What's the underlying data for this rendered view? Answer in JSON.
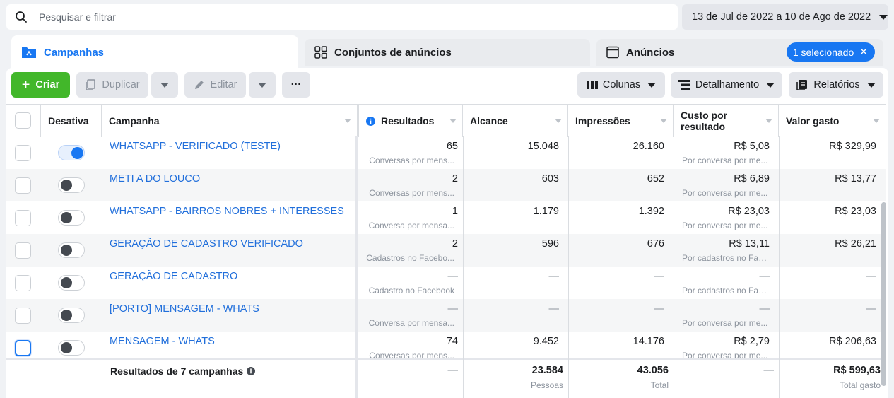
{
  "search": {
    "placeholder": "Pesquisar e filtrar"
  },
  "date_range": "13 de Jul de 2022 a 10 de Ago de 2022",
  "tabs": {
    "campaigns": "Campanhas",
    "adsets": "Conjuntos de anúncios",
    "ads": "Anúncios",
    "selected_chip": "1 selecionado"
  },
  "toolbar": {
    "create": "Criar",
    "duplicate": "Duplicar",
    "edit": "Editar",
    "more": "···",
    "columns": "Colunas",
    "breakdown": "Detalhamento",
    "reports": "Relatórios"
  },
  "columns": {
    "off": "Desativa",
    "campaign": "Campanha",
    "results": "Resultados",
    "reach": "Alcance",
    "impressions": "Impressões",
    "cost_line1": "Custo por",
    "cost_line2": "resultado",
    "spent": "Valor gasto"
  },
  "rows": [
    {
      "name": "WHATSAPP - VERIFICADO (TESTE)",
      "active": true,
      "results": "65",
      "results_sub": "Conversas por mens...",
      "reach": "15.048",
      "impressions": "26.160",
      "cost": "R$ 5,08",
      "cost_sub": "Por conversa por me...",
      "spent": "R$ 329,99"
    },
    {
      "name": "METI A DO LOUCO",
      "active": false,
      "results": "2",
      "results_sub": "Conversas por mens...",
      "reach": "603",
      "impressions": "652",
      "cost": "R$ 6,89",
      "cost_sub": "Por conversa por me...",
      "spent": "R$ 13,77"
    },
    {
      "name": "WHATSAPP - BAIRROS NOBRES + INTERESSES",
      "active": false,
      "results": "1",
      "results_sub": "Conversa por mensa...",
      "reach": "1.179",
      "impressions": "1.392",
      "cost": "R$ 23,03",
      "cost_sub": "Por conversa por me...",
      "spent": "R$ 23,03"
    },
    {
      "name": "GERAÇÃO DE CADASTRO VERIFICADO",
      "active": false,
      "results": "2",
      "results_sub": "Cadastros no Facebo...",
      "reach": "596",
      "impressions": "676",
      "cost": "R$ 13,11",
      "cost_sub": "Por cadastros no Fac...",
      "spent": "R$ 26,21"
    },
    {
      "name": "GERAÇÃO DE CADASTRO",
      "active": false,
      "results": "—",
      "results_sub": "Cadastro no Facebook",
      "reach": "—",
      "impressions": "—",
      "cost": "—",
      "cost_sub": "Por cadastros no Fac...",
      "spent": "—"
    },
    {
      "name": "[PORTO] MENSAGEM - WHATS",
      "active": false,
      "results": "—",
      "results_sub": "Conversa por mensa...",
      "reach": "—",
      "impressions": "—",
      "cost": "—",
      "cost_sub": "Por conversa por me...",
      "spent": "—"
    },
    {
      "name": "MENSAGEM - WHATS",
      "active": false,
      "results": "74",
      "results_sub": "Conversas por mens...",
      "reach": "9.452",
      "impressions": "14.176",
      "cost": "R$ 2,79",
      "cost_sub": "Por conversa por me...",
      "spent": "R$ 206,63"
    }
  ],
  "totals": {
    "label": "Resultados de 7 campanhas",
    "results": "—",
    "reach": "23.584",
    "reach_sub": "Pessoas",
    "impressions": "43.056",
    "impressions_sub": "Total",
    "cost": "—",
    "spent": "R$ 599,63",
    "spent_sub": "Total gasto"
  },
  "colors": {
    "accent": "#1877f2",
    "create": "#42b72a",
    "link": "#216fdb"
  }
}
